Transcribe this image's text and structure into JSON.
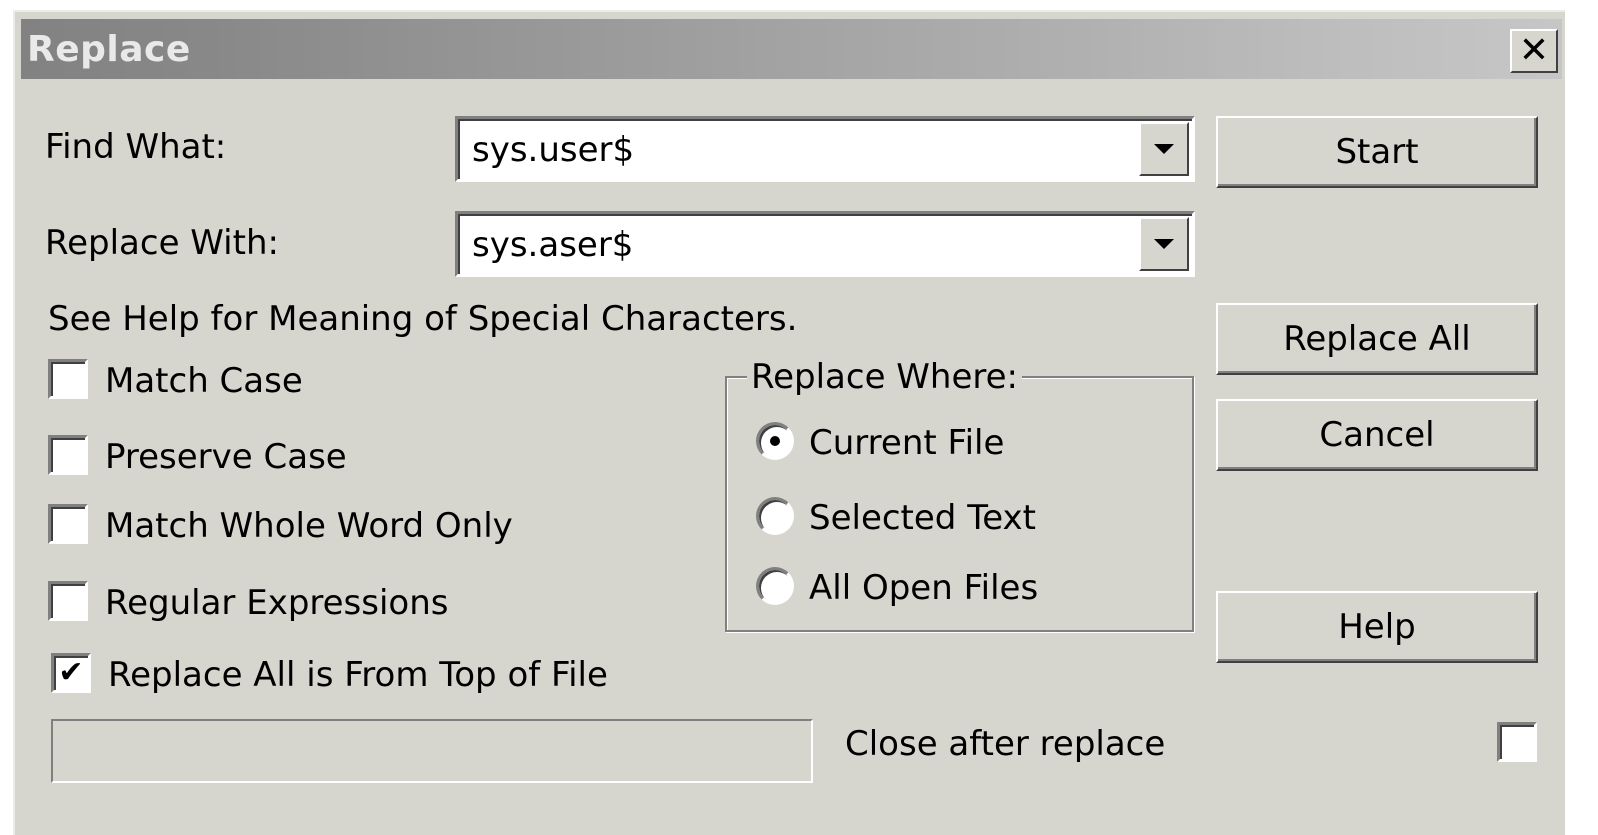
{
  "dialog": {
    "title": "Replace",
    "close_glyph": "✕"
  },
  "find": {
    "label": "Find What:",
    "value": "sys.user$"
  },
  "replace": {
    "label": "Replace With:",
    "value": "sys.aser$"
  },
  "help_text": "See Help for Meaning of Special Characters.",
  "options": {
    "match_case": {
      "label": "Match Case",
      "checked": false
    },
    "preserve_case": {
      "label": "Preserve Case",
      "checked": false
    },
    "match_whole_word": {
      "label": "Match Whole Word Only",
      "checked": false
    },
    "regex": {
      "label": "Regular Expressions",
      "checked": false
    },
    "from_top": {
      "label": "Replace All is From Top of File",
      "checked": true,
      "glyph": "✔"
    }
  },
  "replace_where": {
    "legend": "Replace Where:",
    "current_file": {
      "label": "Current File",
      "selected": true
    },
    "selected_text": {
      "label": "Selected Text",
      "selected": false
    },
    "all_open_files": {
      "label": "All Open Files",
      "selected": false
    }
  },
  "buttons": {
    "start": "Start",
    "replace_all": "Replace All",
    "cancel": "Cancel",
    "help": "Help"
  },
  "close_after_replace": {
    "label": "Close after replace",
    "checked": false
  },
  "icons": {
    "close": "close-icon",
    "dropdown": "chevron-down-icon",
    "check": "checkmark-icon"
  }
}
